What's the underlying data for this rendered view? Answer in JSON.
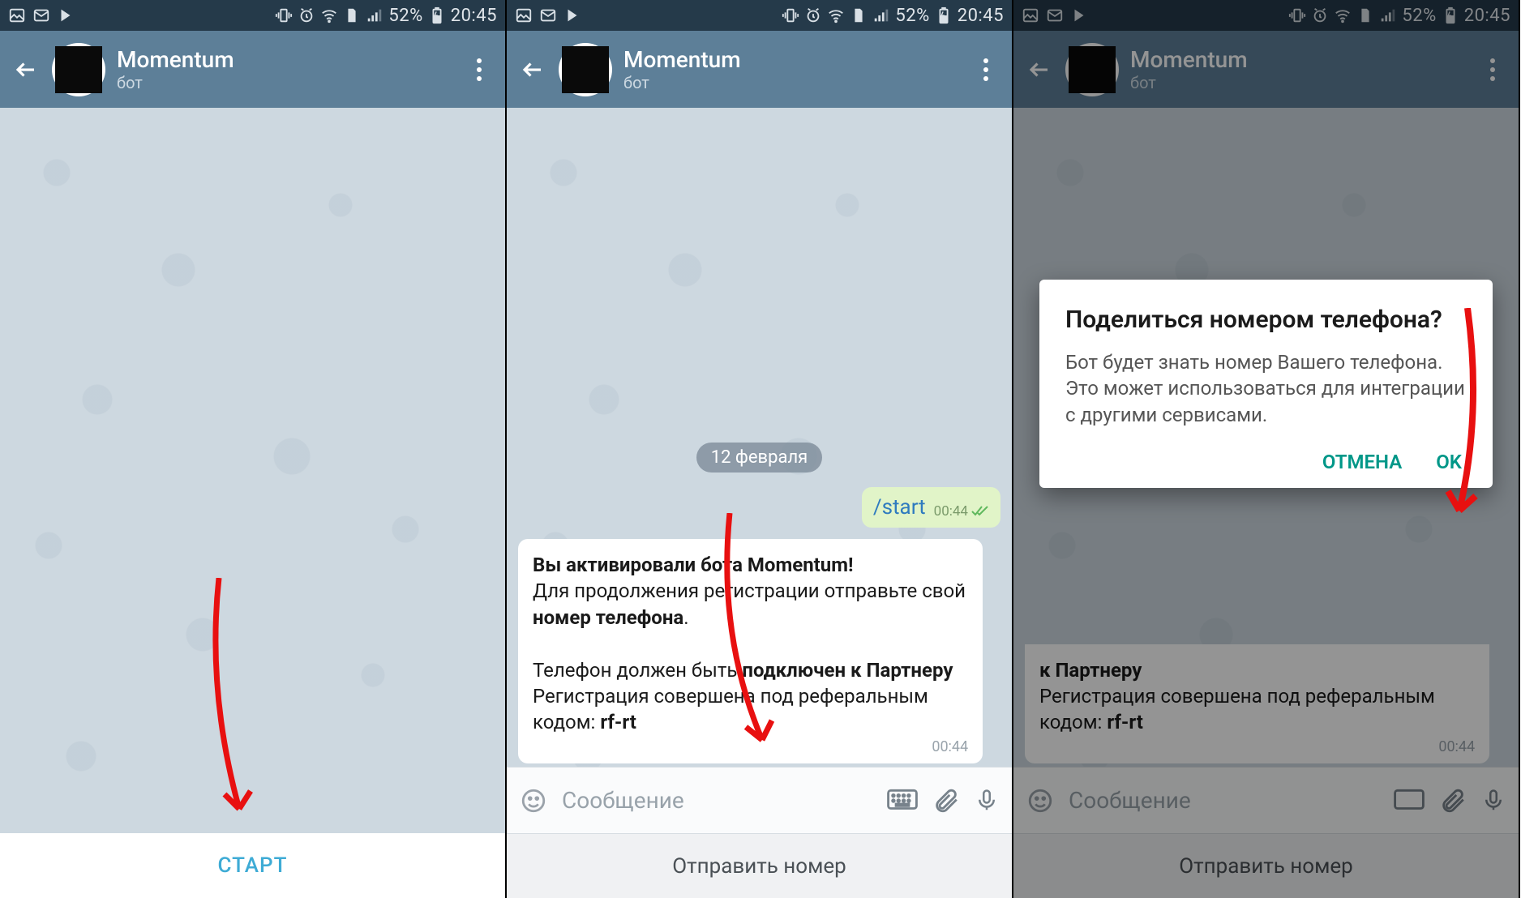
{
  "statusbar": {
    "battery_text": "52%",
    "time": "20:45"
  },
  "header": {
    "title": "Momentum",
    "subtitle": "бот"
  },
  "screen1": {
    "start_button": "СТАРТ"
  },
  "screen2": {
    "date_label": "12 февраля",
    "out_message": {
      "text": "/start",
      "time": "00:44"
    },
    "in_message": {
      "line1_bold": "Вы активировали бота Momentum!",
      "line2a": "Для продолжения регистрации отправьте свой ",
      "line2b_bold": "номер телефона",
      "line2c": ".",
      "line3a": "Телефон должен быть ",
      "line3b_bold": "подключен к Партнеру",
      "line4a": "Регистрация совершена под реферальным кодом: ",
      "line4b_bold": "rf-rt",
      "time": "00:44"
    },
    "input_placeholder": "Сообщение",
    "kb_button": "Отправить номер"
  },
  "screen3": {
    "dialog": {
      "title": "Поделиться номером телефона?",
      "body": "Бот будет знать номер Вашего телефона. Это может использоваться для интеграции с другими сервисами.",
      "cancel": "ОТМЕНА",
      "ok": "OK"
    },
    "in_message_partial": {
      "line3b_bold": "к Партнеру",
      "line4a": "Регистрация совершена под реферальным кодом: ",
      "line4b_bold": "rf-rt",
      "time": "00:44"
    },
    "input_placeholder": "Сообщение",
    "kb_button": "Отправить номер"
  }
}
